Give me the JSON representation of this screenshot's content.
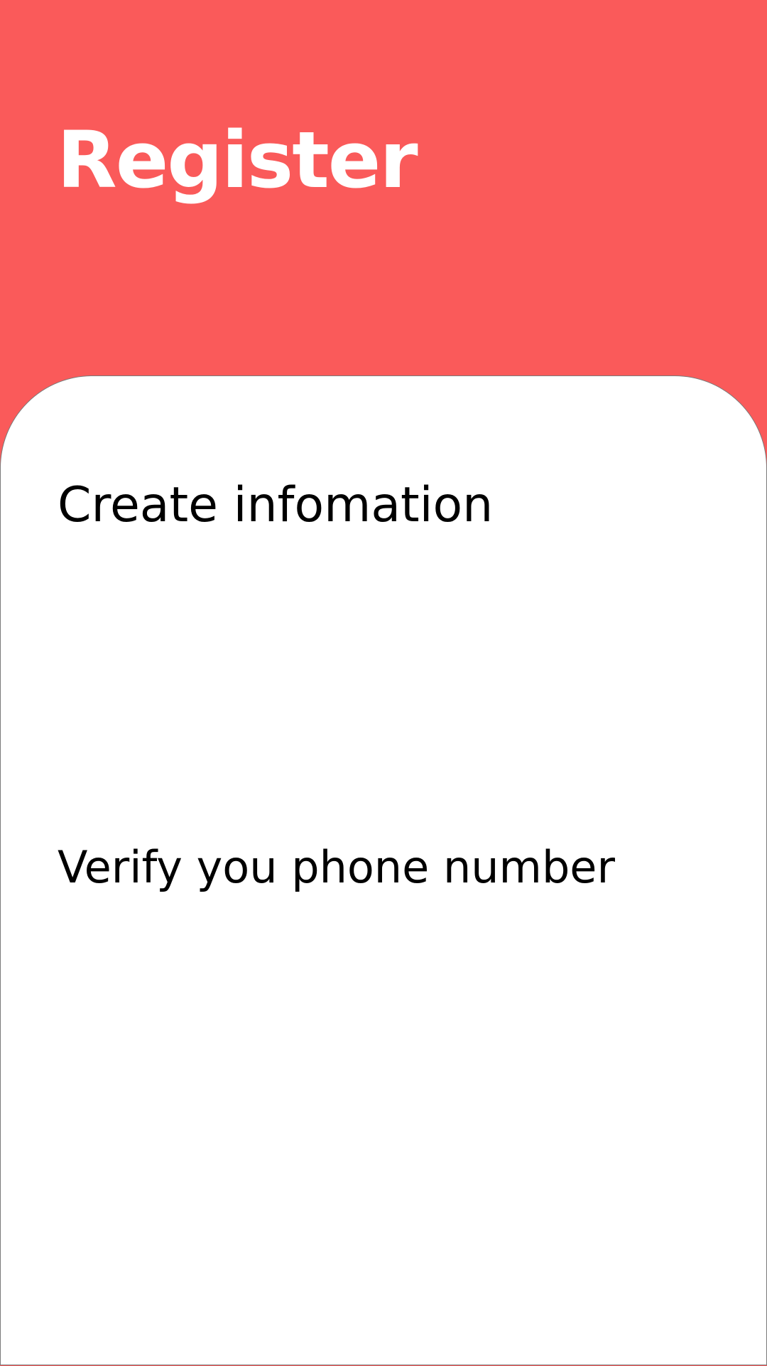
{
  "header": {
    "title": "Register",
    "background_color": "#FA5A5A",
    "text_color": "#FFFFFF"
  },
  "card": {
    "background_color": "#FFFFFF",
    "sections": [
      {
        "heading": "Create infomation"
      },
      {
        "heading": "Verify you phone number"
      }
    ]
  }
}
